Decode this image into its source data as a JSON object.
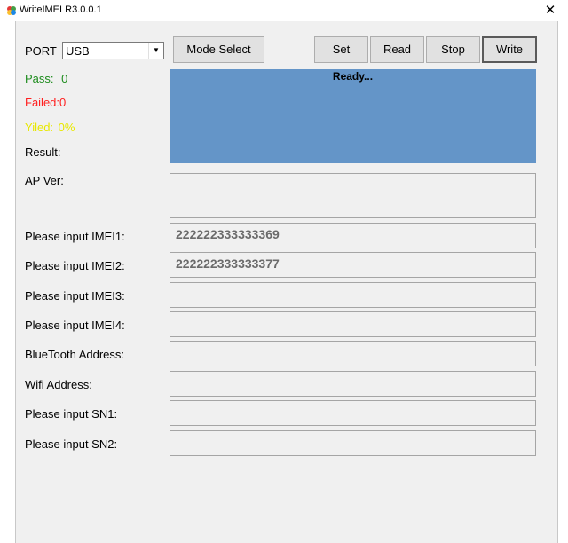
{
  "window": {
    "title": "WriteIMEI R3.0.0.1",
    "close_glyph": "✕",
    "icon": "app-logo-icon"
  },
  "port": {
    "label": "PORT",
    "selected": "USB"
  },
  "toolbar": {
    "mode_select": "Mode Select",
    "set": "Set",
    "read": "Read",
    "stop": "Stop",
    "write": "Write"
  },
  "stats": {
    "pass_label": "Pass:",
    "pass_value": "0",
    "failed_label": "Failed:",
    "failed_value": "0",
    "yield_label": "Yiled:",
    "yield_value": "0%",
    "result_label": "Result:"
  },
  "status": {
    "text": "Ready..."
  },
  "ap_ver": {
    "label": "AP Ver:",
    "value": ""
  },
  "fields": [
    {
      "label": "Please input IMEI1:",
      "value": "222222333333369"
    },
    {
      "label": "Please input IMEI2:",
      "value": "222222333333377"
    },
    {
      "label": "Please input IMEI3:",
      "value": ""
    },
    {
      "label": "Please input IMEI4:",
      "value": ""
    },
    {
      "label": "BlueTooth Address:",
      "value": ""
    },
    {
      "label": "Wifi Address:",
      "value": ""
    },
    {
      "label": "Please input SN1:",
      "value": ""
    },
    {
      "label": "Please input SN2:",
      "value": ""
    }
  ],
  "colors": {
    "pass": "#1e8c1e",
    "failed": "#ff2020",
    "yield": "#e8e800",
    "status_bg": "#6495c8"
  }
}
